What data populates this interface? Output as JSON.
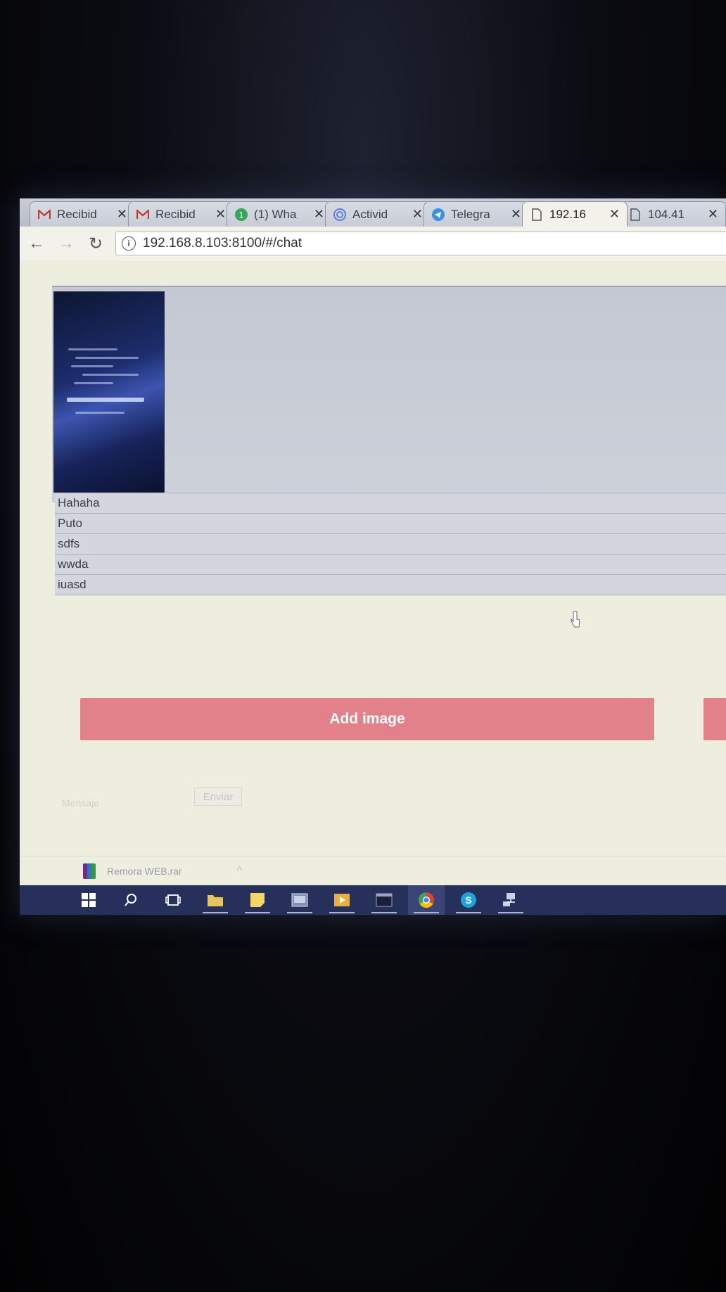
{
  "browser": {
    "tabs": [
      {
        "title": "Recibid",
        "icon": "gmail-icon"
      },
      {
        "title": "Recibid",
        "icon": "gmail-icon"
      },
      {
        "title": "(1) Wha",
        "icon": "whatsapp-icon"
      },
      {
        "title": "Activid",
        "icon": "activity-icon"
      },
      {
        "title": "Telegra",
        "icon": "telegram-icon"
      },
      {
        "title": "192.16",
        "icon": "page-icon",
        "active": true
      },
      {
        "title": "104.41",
        "icon": "page-icon"
      }
    ],
    "address": "192.168.8.103:8100/#/chat"
  },
  "chat": {
    "messages": [
      "Hahaha",
      "Puto",
      "sdfs",
      "wwda",
      "iuasd"
    ],
    "add_image_label": "Add image",
    "input_placeholder": "Mensaje",
    "send_label": "Enviar"
  },
  "download": {
    "filename": "Remora WEB.rar",
    "icon": "rar-archive-icon"
  },
  "taskbar": {
    "items": [
      "windows-start-icon",
      "search-icon",
      "task-view-icon",
      "file-explorer-icon",
      "sticky-notes-icon",
      "app-icon",
      "media-player-icon",
      "terminal-icon",
      "chrome-icon",
      "skype-icon",
      "network-icon"
    ],
    "accent": "#26305a"
  },
  "colors": {
    "button": "#e2818a",
    "page_bg": "#eeeedf"
  }
}
